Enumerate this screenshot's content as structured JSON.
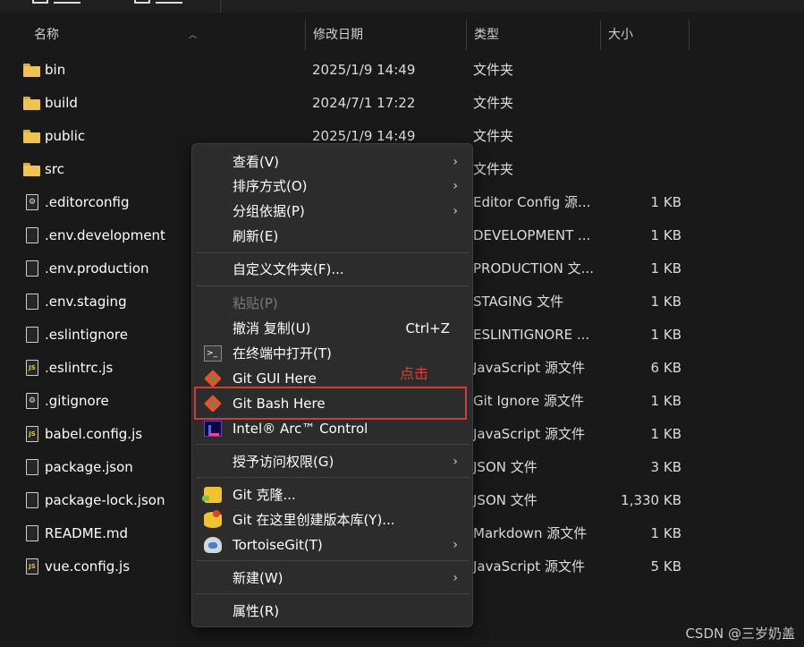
{
  "header": {
    "name": "名称",
    "date": "修改日期",
    "type": "类型",
    "size": "大小"
  },
  "files": [
    {
      "name": "bin",
      "date": "2025/1/9 14:49",
      "type": "文件夹",
      "size": "",
      "icon": "folder-icon"
    },
    {
      "name": "build",
      "date": "2024/7/1 17:22",
      "type": "文件夹",
      "size": "",
      "icon": "folder-icon"
    },
    {
      "name": "public",
      "date": "2025/1/9 14:49",
      "type": "文件夹",
      "size": "",
      "icon": "folder-icon"
    },
    {
      "name": "src",
      "date": "",
      "type": "文件夹",
      "size": "",
      "icon": "folder-icon"
    },
    {
      "name": ".editorconfig",
      "date": "",
      "type": "Editor Config 源...",
      "size": "1 KB",
      "icon": "config-file-icon"
    },
    {
      "name": ".env.development",
      "date": "",
      "type": "DEVELOPMENT ...",
      "size": "1 KB",
      "icon": "file-icon"
    },
    {
      "name": ".env.production",
      "date": "",
      "type": "PRODUCTION 文...",
      "size": "1 KB",
      "icon": "file-icon"
    },
    {
      "name": ".env.staging",
      "date": "",
      "type": "STAGING 文件",
      "size": "1 KB",
      "icon": "file-icon"
    },
    {
      "name": ".eslintignore",
      "date": "",
      "type": "ESLINTIGNORE ...",
      "size": "1 KB",
      "icon": "file-icon"
    },
    {
      "name": ".eslintrc.js",
      "date": "",
      "type": "JavaScript 源文件",
      "size": "6 KB",
      "icon": "js-file-icon"
    },
    {
      "name": ".gitignore",
      "date": "",
      "type": "Git Ignore 源文件",
      "size": "1 KB",
      "icon": "config-file-icon"
    },
    {
      "name": "babel.config.js",
      "date": "",
      "type": "JavaScript 源文件",
      "size": "1 KB",
      "icon": "js-file-icon"
    },
    {
      "name": "package.json",
      "date": "",
      "type": "JSON 文件",
      "size": "3 KB",
      "icon": "file-icon"
    },
    {
      "name": "package-lock.json",
      "date": "",
      "type": "JSON 文件",
      "size": "1,330 KB",
      "icon": "file-icon"
    },
    {
      "name": "README.md",
      "date": "",
      "type": "Markdown 源文件",
      "size": "1 KB",
      "icon": "file-icon"
    },
    {
      "name": "vue.config.js",
      "date": "",
      "type": "JavaScript 源文件",
      "size": "5 KB",
      "icon": "js-file-icon"
    }
  ],
  "context_menu": {
    "view": "查看(V)",
    "sort": "排序方式(O)",
    "group": "分组依据(P)",
    "refresh": "刷新(E)",
    "customize": "自定义文件夹(F)...",
    "paste": "粘贴(P)",
    "undo": "撤消 复制(U)",
    "undo_shortcut": "Ctrl+Z",
    "terminal": "在终端中打开(T)",
    "git_gui": "Git GUI Here",
    "git_bash": "Git Bash Here",
    "intel_arc": "Intel® Arc™ Control",
    "give_access": "授予访问权限(G)",
    "git_clone": "Git 克隆...",
    "git_create_repo": "Git 在这里创建版本库(Y)...",
    "tortoise": "TortoiseGit(T)",
    "new": "新建(W)",
    "properties": "属性(R)"
  },
  "annotation": "点击",
  "watermark": "CSDN @三岁奶盖",
  "colors": {
    "background": "#191919",
    "menu_background": "#2c2c2c",
    "highlight_border": "#d13b3b",
    "annotation": "#e0412f",
    "folder": "#f0c24f"
  }
}
